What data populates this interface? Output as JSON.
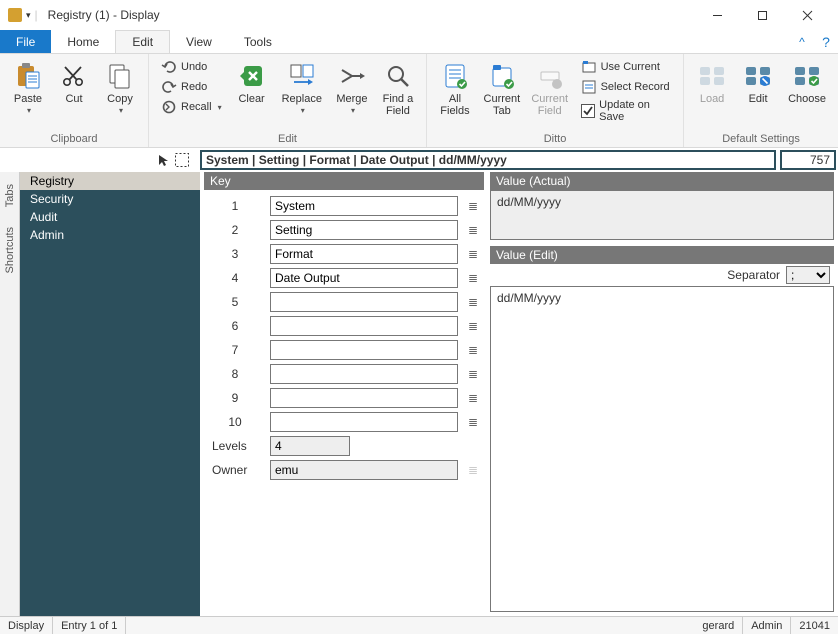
{
  "window": {
    "title": "Registry (1) - Display"
  },
  "ribbonTabs": {
    "file": "File",
    "home": "Home",
    "edit": "Edit",
    "view": "View",
    "tools": "Tools"
  },
  "ribbon": {
    "clipboard": {
      "label": "Clipboard",
      "paste": "Paste",
      "cut": "Cut",
      "copy": "Copy"
    },
    "edit": {
      "label": "Edit",
      "undo": "Undo",
      "redo": "Redo",
      "recall": "Recall",
      "clear": "Clear",
      "replace": "Replace",
      "merge": "Merge",
      "find": "Find a\nField"
    },
    "ditto": {
      "label": "Ditto",
      "allFields": "All\nFields",
      "currentTab": "Current\nTab",
      "currentField": "Current\nField",
      "useCurrent": "Use Current",
      "selectRecord": "Select Record",
      "updateOnSave": "Update on Save"
    },
    "defaults": {
      "label": "Default Settings",
      "load": "Load",
      "edit": "Edit",
      "choose": "Choose"
    }
  },
  "pathbar": {
    "path": "System | Setting | Format | Date Output | dd/MM/yyyy",
    "count": "757"
  },
  "verticalTabs": {
    "tabs": "Tabs",
    "shortcuts": "Shortcuts"
  },
  "sidebar": {
    "items": [
      {
        "label": "Registry",
        "active": true
      },
      {
        "label": "Security",
        "active": false
      },
      {
        "label": "Audit",
        "active": false
      },
      {
        "label": "Admin",
        "active": false
      }
    ]
  },
  "keyPanel": {
    "header": "Key",
    "rows": [
      {
        "n": "1",
        "v": "System"
      },
      {
        "n": "2",
        "v": "Setting"
      },
      {
        "n": "3",
        "v": "Format"
      },
      {
        "n": "4",
        "v": "Date Output"
      },
      {
        "n": "5",
        "v": ""
      },
      {
        "n": "6",
        "v": ""
      },
      {
        "n": "7",
        "v": ""
      },
      {
        "n": "8",
        "v": ""
      },
      {
        "n": "9",
        "v": ""
      },
      {
        "n": "10",
        "v": ""
      }
    ],
    "levelsLabel": "Levels",
    "levelsValue": "4",
    "ownerLabel": "Owner",
    "ownerValue": "emu"
  },
  "valueActual": {
    "header": "Value (Actual)",
    "value": "dd/MM/yyyy"
  },
  "valueEdit": {
    "header": "Value (Edit)",
    "separatorLabel": "Separator",
    "separatorValue": ";",
    "value": "dd/MM/yyyy"
  },
  "statusbar": {
    "mode": "Display",
    "entry": "Entry 1 of 1",
    "user": "gerard",
    "role": "Admin",
    "build": "21041"
  }
}
